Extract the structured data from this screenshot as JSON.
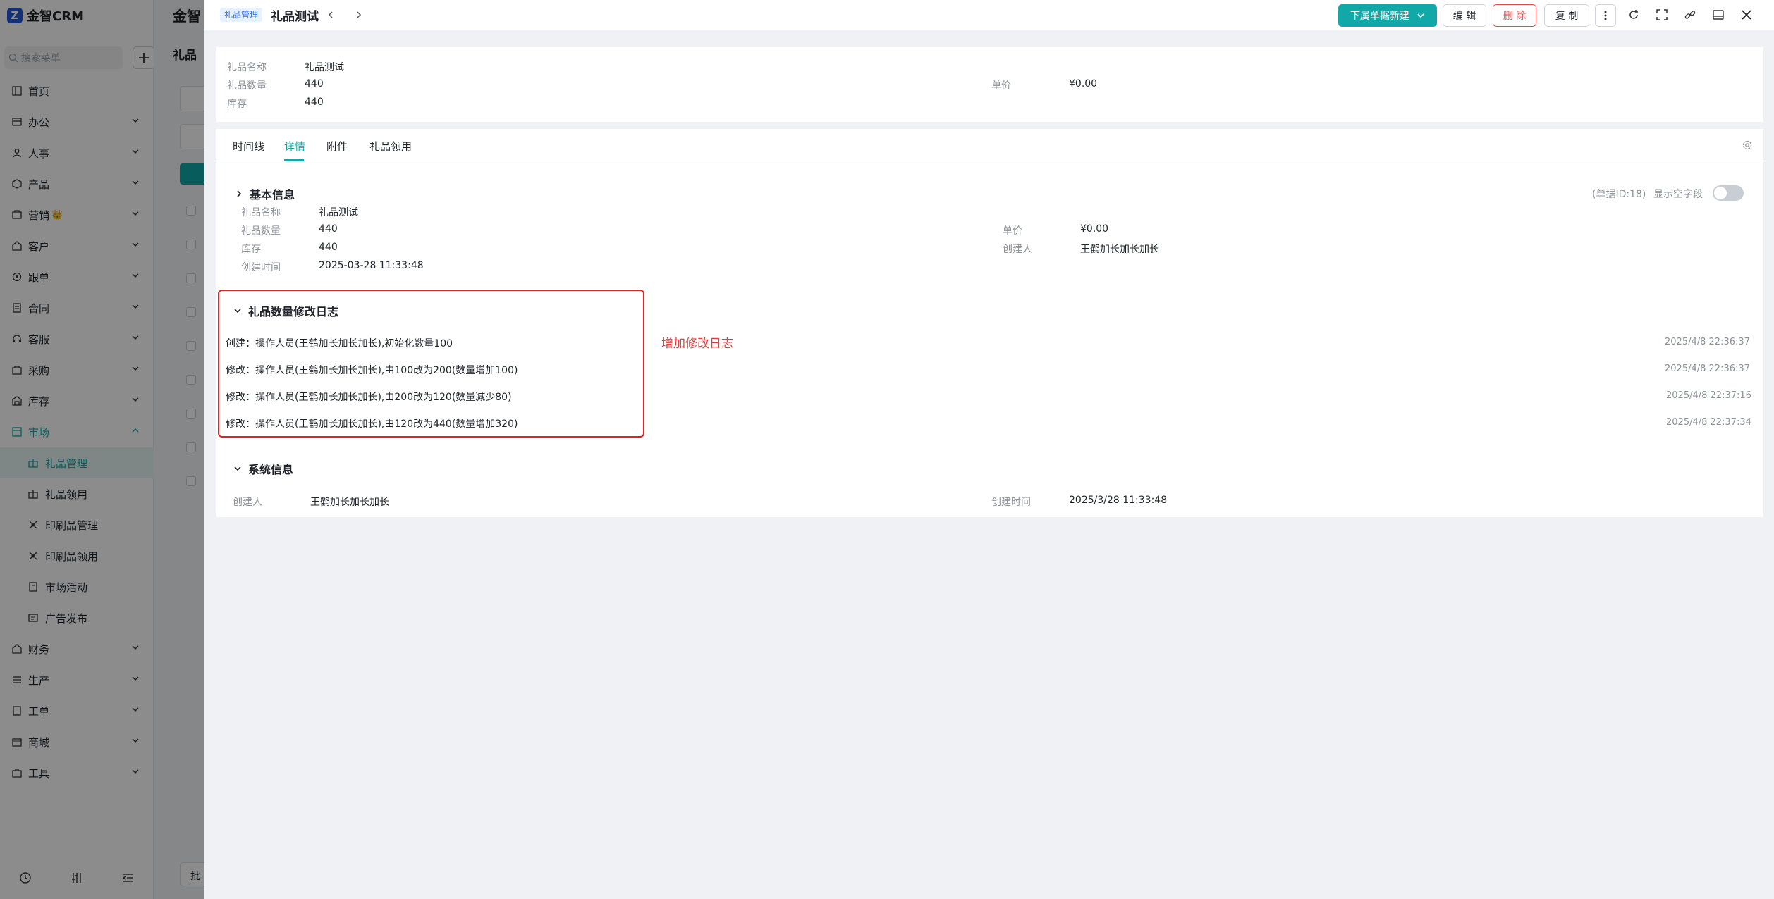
{
  "app": {
    "logo_mark": "Z",
    "name": "金智CRM"
  },
  "sidebar": {
    "search_placeholder": "搜索菜单",
    "add_symbol": "+",
    "items": [
      {
        "label": "首页",
        "icon": "home-icon",
        "has_children": false
      },
      {
        "label": "办公",
        "icon": "office-icon",
        "has_children": true
      },
      {
        "label": "人事",
        "icon": "people-icon",
        "has_children": true
      },
      {
        "label": "产品",
        "icon": "box-icon",
        "has_children": true
      },
      {
        "label": "营销",
        "icon": "marketing-icon",
        "badge": "👑",
        "has_children": true
      },
      {
        "label": "客户",
        "icon": "customer-icon",
        "has_children": true
      },
      {
        "label": "跟单",
        "icon": "follow-icon",
        "has_children": true
      },
      {
        "label": "合同",
        "icon": "contract-icon",
        "has_children": true
      },
      {
        "label": "客服",
        "icon": "service-icon",
        "has_children": true
      },
      {
        "label": "采购",
        "icon": "purchase-icon",
        "has_children": true
      },
      {
        "label": "库存",
        "icon": "warehouse-icon",
        "has_children": true
      }
    ],
    "market": {
      "label": "市场",
      "children": [
        "礼品管理",
        "礼品领用",
        "印刷品管理",
        "印刷品领用",
        "市场活动",
        "广告发布"
      ]
    },
    "items_after": [
      {
        "label": "财务",
        "icon": "finance-icon"
      },
      {
        "label": "生产",
        "icon": "production-icon"
      },
      {
        "label": "工单",
        "icon": "ticket-icon"
      },
      {
        "label": "商城",
        "icon": "shop-icon"
      },
      {
        "label": "工具",
        "icon": "tool-icon"
      }
    ]
  },
  "background_page": {
    "title": "金智",
    "subtitle": "礼品",
    "button": "批"
  },
  "drawer": {
    "module_tag": "礼品管理",
    "title": "礼品测试",
    "buttons": {
      "create_sub": "下属单据新建",
      "edit": "编 辑",
      "delete": "删 除",
      "copy": "复 制"
    },
    "summary": {
      "name_label": "礼品名称",
      "name": "礼品测试",
      "qty_label": "礼品数量",
      "qty": "440",
      "stock_label": "库存",
      "stock": "440",
      "price_label": "单价",
      "price": "¥0.00"
    },
    "tabs": [
      "时间线",
      "详情",
      "附件",
      "礼品领用"
    ],
    "active_tab": "详情",
    "basic": {
      "title": "基本信息",
      "doc_id": "(单据ID:18)",
      "show_empty_label": "显示空字段",
      "show_empty": false,
      "name_label": "礼品名称",
      "name": "礼品测试",
      "qty_label": "礼品数量",
      "qty": "440",
      "stock_label": "库存",
      "stock": "440",
      "created_label": "创建时间",
      "created": "2025-03-28 11:33:48",
      "price_label": "单价",
      "price": "¥0.00",
      "creator_label": "创建人",
      "creator": "王鹤加长加长加长"
    },
    "log": {
      "title": "礼品数量修改日志",
      "entries": [
        {
          "text": "创建：操作人员(王鹤加长加长加长),初始化数量100",
          "time": "2025/4/8 22:36:37"
        },
        {
          "text": "修改：操作人员(王鹤加长加长加长),由100改为200(数量增加100)",
          "time": "2025/4/8 22:36:37"
        },
        {
          "text": "修改：操作人员(王鹤加长加长加长),由200改为120(数量减少80)",
          "time": "2025/4/8 22:37:16"
        },
        {
          "text": "修改：操作人员(王鹤加长加长加长),由120改为440(数量增加320)",
          "time": "2025/4/8 22:37:34"
        }
      ]
    },
    "annotation": "增加修改日志",
    "system": {
      "title": "系统信息",
      "creator_label": "创建人",
      "creator": "王鹤加长加长加长",
      "created_label": "创建时间",
      "created": "2025/3/28 11:33:48"
    }
  },
  "colors": {
    "accent": "#12a8a8",
    "danger": "#e84a4a",
    "annotation": "#e52222",
    "tag_bg": "#e8f1ff",
    "tag_text": "#2f6fe0"
  }
}
